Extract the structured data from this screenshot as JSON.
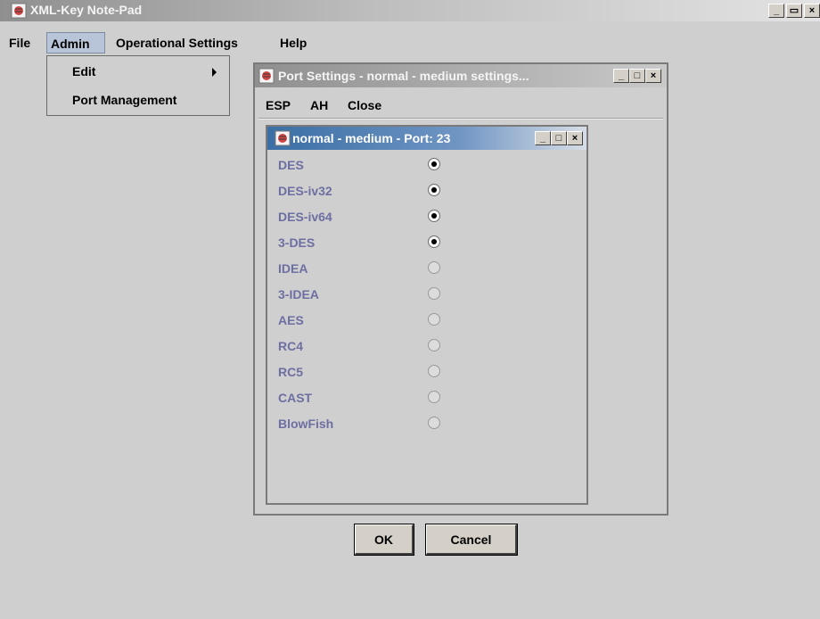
{
  "app": {
    "title": "XML-Key Note-Pad"
  },
  "window_controls": {
    "minimize": "_",
    "restore": "🗗",
    "close": "×"
  },
  "menubar": [
    "File",
    "Admin",
    "Operational Settings",
    "Help"
  ],
  "admin_menu": {
    "edit": "Edit",
    "port_management": "Port Management"
  },
  "port_window": {
    "title": "Port Settings - normal - medium settings...",
    "menu": [
      "ESP",
      "AH",
      "Close"
    ]
  },
  "inner_window": {
    "title": "normal - medium - Port: 23",
    "algorithms": [
      {
        "name": "DES",
        "selected": true
      },
      {
        "name": "DES-iv32",
        "selected": true
      },
      {
        "name": "DES-iv64",
        "selected": true
      },
      {
        "name": "3-DES",
        "selected": true
      },
      {
        "name": "IDEA",
        "selected": false
      },
      {
        "name": "3-IDEA",
        "selected": false
      },
      {
        "name": "AES",
        "selected": false
      },
      {
        "name": "RC4",
        "selected": false
      },
      {
        "name": "RC5",
        "selected": false
      },
      {
        "name": "CAST",
        "selected": false
      },
      {
        "name": "BlowFish",
        "selected": false
      }
    ],
    "ok_label": "OK",
    "cancel_label": "Cancel"
  },
  "colors": {
    "label_color": "#6d6fa2",
    "active_title": "#3a6ea5",
    "background": "#cfcfcf"
  }
}
